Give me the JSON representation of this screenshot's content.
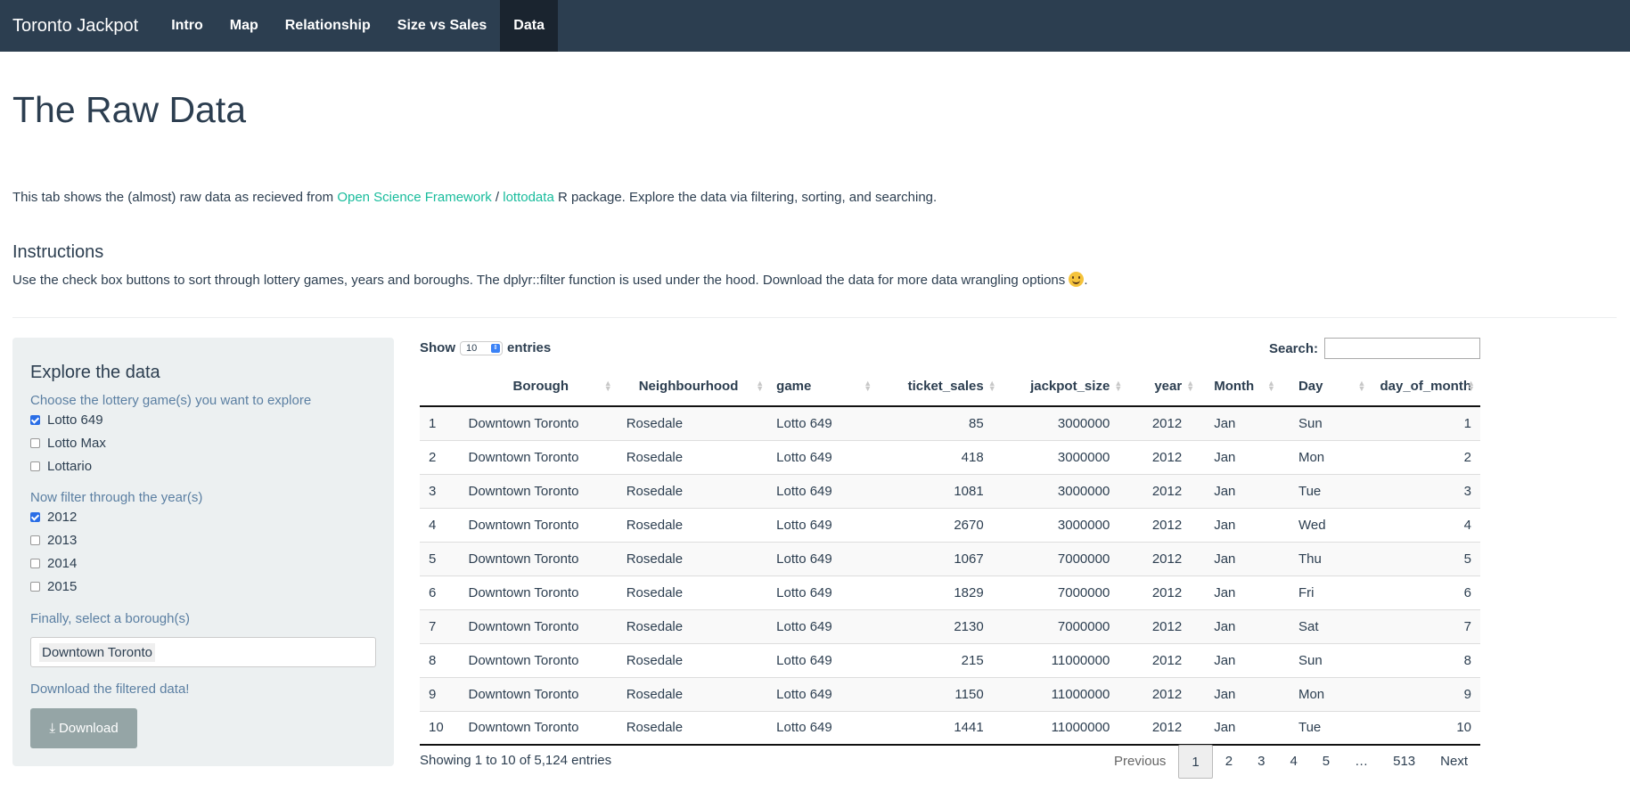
{
  "navbar": {
    "brand": "Toronto Jackpot",
    "items": [
      "Intro",
      "Map",
      "Relationship",
      "Size vs Sales",
      "Data"
    ],
    "active": "Data"
  },
  "header": {
    "title": "The Raw Data",
    "intro_before": "This tab shows the (almost) raw data as recieved from ",
    "link1": "Open Science Framework",
    "sep": " / ",
    "link2": "lottodata",
    "intro_after": " R package. Explore the data via filtering, sorting, and searching.",
    "instructions_title": "Instructions",
    "instructions_text": "Use the check box buttons to sort through lottery games, years and boroughs. The dplyr::filter function is used under the hood. Download the data for more data wrangling options ",
    "instructions_end": "."
  },
  "sidebar": {
    "title": "Explore the data",
    "game_label": "Choose the lottery game(s) you want to explore",
    "games": [
      {
        "label": "Lotto 649",
        "checked": true
      },
      {
        "label": "Lotto Max",
        "checked": false
      },
      {
        "label": "Lottario",
        "checked": false
      }
    ],
    "year_label": "Now filter through the year(s)",
    "years": [
      {
        "label": "2012",
        "checked": true
      },
      {
        "label": "2013",
        "checked": false
      },
      {
        "label": "2014",
        "checked": false
      },
      {
        "label": "2015",
        "checked": false
      }
    ],
    "borough_label": "Finally, select a borough(s)",
    "borough_selected": "Downtown Toronto",
    "download_label": "Download the filtered data!",
    "download_button": "Download"
  },
  "table": {
    "show": "Show",
    "entries_value": "10",
    "entries": "entries",
    "search_label": "Search:",
    "columns": [
      "",
      "Borough",
      "Neighbourhood",
      "game",
      "ticket_sales",
      "jackpot_size",
      "year",
      "Month",
      "Day",
      "day_of_month"
    ],
    "rows": [
      [
        "1",
        "Downtown Toronto",
        "Rosedale",
        "Lotto 649",
        "85",
        "3000000",
        "2012",
        "Jan",
        "Sun",
        "1"
      ],
      [
        "2",
        "Downtown Toronto",
        "Rosedale",
        "Lotto 649",
        "418",
        "3000000",
        "2012",
        "Jan",
        "Mon",
        "2"
      ],
      [
        "3",
        "Downtown Toronto",
        "Rosedale",
        "Lotto 649",
        "1081",
        "3000000",
        "2012",
        "Jan",
        "Tue",
        "3"
      ],
      [
        "4",
        "Downtown Toronto",
        "Rosedale",
        "Lotto 649",
        "2670",
        "3000000",
        "2012",
        "Jan",
        "Wed",
        "4"
      ],
      [
        "5",
        "Downtown Toronto",
        "Rosedale",
        "Lotto 649",
        "1067",
        "7000000",
        "2012",
        "Jan",
        "Thu",
        "5"
      ],
      [
        "6",
        "Downtown Toronto",
        "Rosedale",
        "Lotto 649",
        "1829",
        "7000000",
        "2012",
        "Jan",
        "Fri",
        "6"
      ],
      [
        "7",
        "Downtown Toronto",
        "Rosedale",
        "Lotto 649",
        "2130",
        "7000000",
        "2012",
        "Jan",
        "Sat",
        "7"
      ],
      [
        "8",
        "Downtown Toronto",
        "Rosedale",
        "Lotto 649",
        "215",
        "11000000",
        "2012",
        "Jan",
        "Sun",
        "8"
      ],
      [
        "9",
        "Downtown Toronto",
        "Rosedale",
        "Lotto 649",
        "1150",
        "11000000",
        "2012",
        "Jan",
        "Mon",
        "9"
      ],
      [
        "10",
        "Downtown Toronto",
        "Rosedale",
        "Lotto 649",
        "1441",
        "11000000",
        "2012",
        "Jan",
        "Tue",
        "10"
      ]
    ],
    "info": "Showing 1 to 10 of 5,124 entries",
    "pager": [
      "Previous",
      "1",
      "2",
      "3",
      "4",
      "5",
      "…",
      "513",
      "Next"
    ],
    "current_page": "1"
  }
}
